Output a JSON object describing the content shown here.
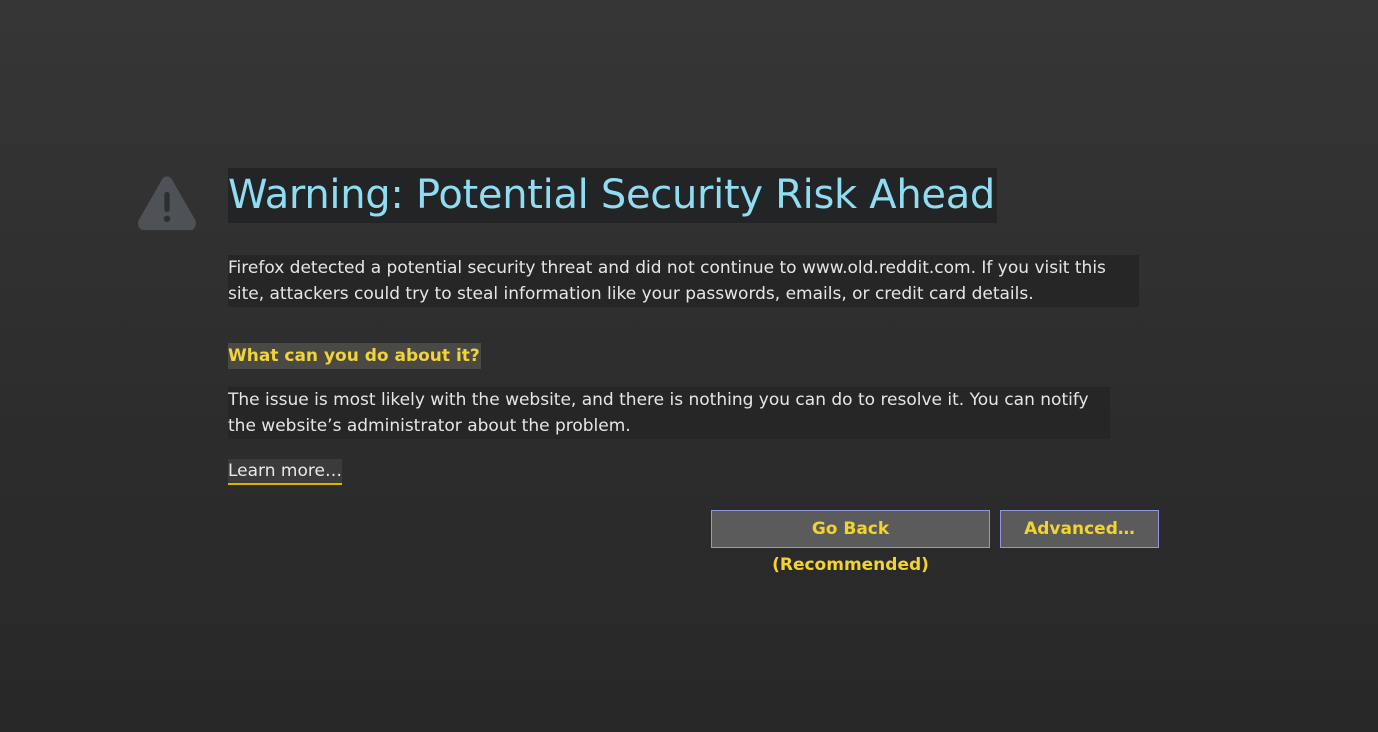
{
  "page": {
    "title": "Warning: Potential Security Risk Ahead",
    "intro": "Firefox detected a potential security threat and did not continue to www.old.reddit.com. If you visit this site, attackers could try to steal information like your passwords, emails, or credit card details.",
    "subheading": "What can you do about it?",
    "explanation": "The issue is most likely with the website, and there is nothing you can do to resolve it. You can notify the website’s administrator about the problem.",
    "learn_more": "Learn more…"
  },
  "buttons": {
    "go_back": "Go Back (Recommended)",
    "advanced": "Advanced…"
  },
  "icons": {
    "warning": "warning-triangle-icon"
  },
  "colors": {
    "title": "#8fdcf3",
    "accent": "#f1d33a",
    "button_border": "#8e96e6",
    "background": "#2f2f2f"
  }
}
